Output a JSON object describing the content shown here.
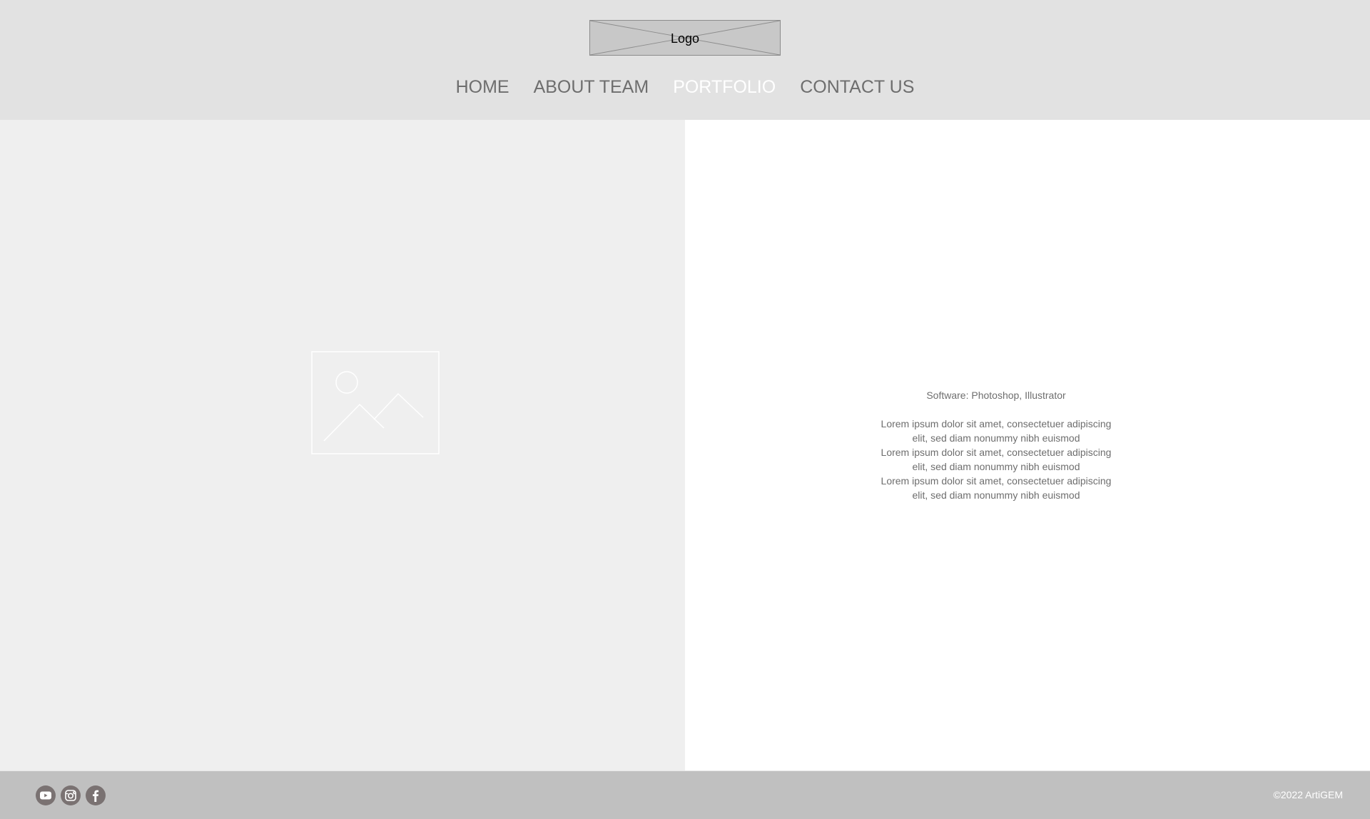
{
  "header": {
    "logo_text": "Logo",
    "nav": [
      {
        "label": "HOME",
        "active": false
      },
      {
        "label": "ABOUT TEAM",
        "active": false
      },
      {
        "label": "PORTFOLIO",
        "active": true
      },
      {
        "label": "CONTACT US",
        "active": false
      }
    ]
  },
  "main": {
    "image_icon": "image-placeholder-icon",
    "software": "Software: Photoshop, Illustrator",
    "description_lines": [
      "Lorem ipsum dolor sit amet, consectetuer adipiscing",
      "elit, sed diam nonummy nibh euismod",
      "Lorem ipsum dolor sit amet, consectetuer adipiscing",
      "elit, sed diam nonummy nibh euismod",
      "Lorem ipsum dolor sit amet, consectetuer adipiscing",
      "elit, sed diam nonummy nibh euismod"
    ]
  },
  "footer": {
    "social_icons": [
      "youtube-icon",
      "instagram-icon",
      "facebook-icon"
    ],
    "copyright": "©2022 ArtiGEM"
  },
  "colors": {
    "header_bg": "#e2e2e2",
    "nav_text": "#6e6e6e",
    "nav_active": "#ffffff",
    "left_panel_bg": "#efefef",
    "footer_bg": "#c0c0c0",
    "social_icon_bg": "#7a7272"
  }
}
